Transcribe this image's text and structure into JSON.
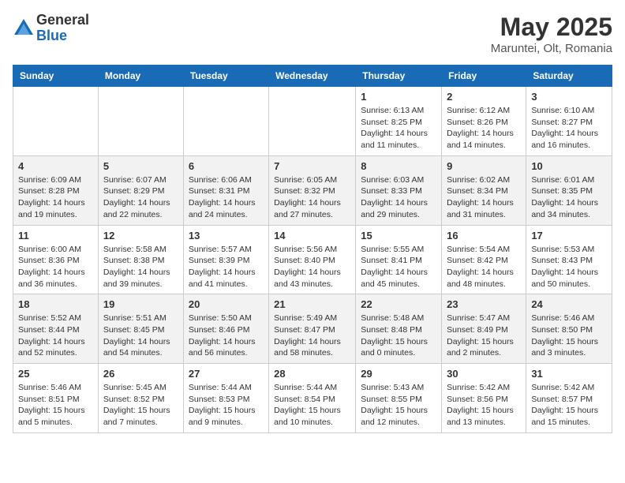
{
  "logo": {
    "general": "General",
    "blue": "Blue"
  },
  "title": {
    "month": "May 2025",
    "location": "Maruntei, Olt, Romania"
  },
  "days_of_week": [
    "Sunday",
    "Monday",
    "Tuesday",
    "Wednesday",
    "Thursday",
    "Friday",
    "Saturday"
  ],
  "weeks": [
    [
      {
        "day": "",
        "detail": ""
      },
      {
        "day": "",
        "detail": ""
      },
      {
        "day": "",
        "detail": ""
      },
      {
        "day": "",
        "detail": ""
      },
      {
        "day": "1",
        "detail": "Sunrise: 6:13 AM\nSunset: 8:25 PM\nDaylight: 14 hours\nand 11 minutes."
      },
      {
        "day": "2",
        "detail": "Sunrise: 6:12 AM\nSunset: 8:26 PM\nDaylight: 14 hours\nand 14 minutes."
      },
      {
        "day": "3",
        "detail": "Sunrise: 6:10 AM\nSunset: 8:27 PM\nDaylight: 14 hours\nand 16 minutes."
      }
    ],
    [
      {
        "day": "4",
        "detail": "Sunrise: 6:09 AM\nSunset: 8:28 PM\nDaylight: 14 hours\nand 19 minutes."
      },
      {
        "day": "5",
        "detail": "Sunrise: 6:07 AM\nSunset: 8:29 PM\nDaylight: 14 hours\nand 22 minutes."
      },
      {
        "day": "6",
        "detail": "Sunrise: 6:06 AM\nSunset: 8:31 PM\nDaylight: 14 hours\nand 24 minutes."
      },
      {
        "day": "7",
        "detail": "Sunrise: 6:05 AM\nSunset: 8:32 PM\nDaylight: 14 hours\nand 27 minutes."
      },
      {
        "day": "8",
        "detail": "Sunrise: 6:03 AM\nSunset: 8:33 PM\nDaylight: 14 hours\nand 29 minutes."
      },
      {
        "day": "9",
        "detail": "Sunrise: 6:02 AM\nSunset: 8:34 PM\nDaylight: 14 hours\nand 31 minutes."
      },
      {
        "day": "10",
        "detail": "Sunrise: 6:01 AM\nSunset: 8:35 PM\nDaylight: 14 hours\nand 34 minutes."
      }
    ],
    [
      {
        "day": "11",
        "detail": "Sunrise: 6:00 AM\nSunset: 8:36 PM\nDaylight: 14 hours\nand 36 minutes."
      },
      {
        "day": "12",
        "detail": "Sunrise: 5:58 AM\nSunset: 8:38 PM\nDaylight: 14 hours\nand 39 minutes."
      },
      {
        "day": "13",
        "detail": "Sunrise: 5:57 AM\nSunset: 8:39 PM\nDaylight: 14 hours\nand 41 minutes."
      },
      {
        "day": "14",
        "detail": "Sunrise: 5:56 AM\nSunset: 8:40 PM\nDaylight: 14 hours\nand 43 minutes."
      },
      {
        "day": "15",
        "detail": "Sunrise: 5:55 AM\nSunset: 8:41 PM\nDaylight: 14 hours\nand 45 minutes."
      },
      {
        "day": "16",
        "detail": "Sunrise: 5:54 AM\nSunset: 8:42 PM\nDaylight: 14 hours\nand 48 minutes."
      },
      {
        "day": "17",
        "detail": "Sunrise: 5:53 AM\nSunset: 8:43 PM\nDaylight: 14 hours\nand 50 minutes."
      }
    ],
    [
      {
        "day": "18",
        "detail": "Sunrise: 5:52 AM\nSunset: 8:44 PM\nDaylight: 14 hours\nand 52 minutes."
      },
      {
        "day": "19",
        "detail": "Sunrise: 5:51 AM\nSunset: 8:45 PM\nDaylight: 14 hours\nand 54 minutes."
      },
      {
        "day": "20",
        "detail": "Sunrise: 5:50 AM\nSunset: 8:46 PM\nDaylight: 14 hours\nand 56 minutes."
      },
      {
        "day": "21",
        "detail": "Sunrise: 5:49 AM\nSunset: 8:47 PM\nDaylight: 14 hours\nand 58 minutes."
      },
      {
        "day": "22",
        "detail": "Sunrise: 5:48 AM\nSunset: 8:48 PM\nDaylight: 15 hours\nand 0 minutes."
      },
      {
        "day": "23",
        "detail": "Sunrise: 5:47 AM\nSunset: 8:49 PM\nDaylight: 15 hours\nand 2 minutes."
      },
      {
        "day": "24",
        "detail": "Sunrise: 5:46 AM\nSunset: 8:50 PM\nDaylight: 15 hours\nand 3 minutes."
      }
    ],
    [
      {
        "day": "25",
        "detail": "Sunrise: 5:46 AM\nSunset: 8:51 PM\nDaylight: 15 hours\nand 5 minutes."
      },
      {
        "day": "26",
        "detail": "Sunrise: 5:45 AM\nSunset: 8:52 PM\nDaylight: 15 hours\nand 7 minutes."
      },
      {
        "day": "27",
        "detail": "Sunrise: 5:44 AM\nSunset: 8:53 PM\nDaylight: 15 hours\nand 9 minutes."
      },
      {
        "day": "28",
        "detail": "Sunrise: 5:44 AM\nSunset: 8:54 PM\nDaylight: 15 hours\nand 10 minutes."
      },
      {
        "day": "29",
        "detail": "Sunrise: 5:43 AM\nSunset: 8:55 PM\nDaylight: 15 hours\nand 12 minutes."
      },
      {
        "day": "30",
        "detail": "Sunrise: 5:42 AM\nSunset: 8:56 PM\nDaylight: 15 hours\nand 13 minutes."
      },
      {
        "day": "31",
        "detail": "Sunrise: 5:42 AM\nSunset: 8:57 PM\nDaylight: 15 hours\nand 15 minutes."
      }
    ]
  ]
}
